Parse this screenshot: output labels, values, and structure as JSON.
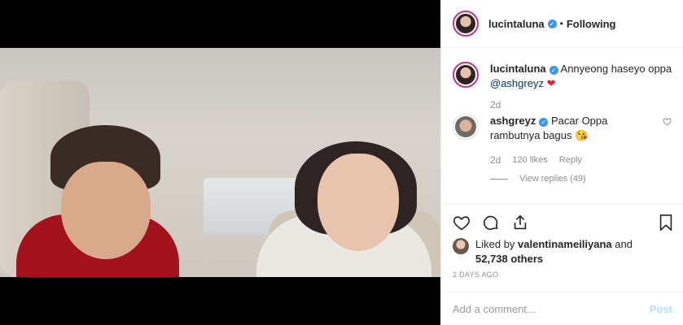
{
  "header": {
    "username": "lucintaluna",
    "separator": "•",
    "follow_status": "Following"
  },
  "caption": {
    "username": "lucintaluna",
    "text": "Annyeong haseyo oppa",
    "mention": "@ashgreyz",
    "emoji": "❤",
    "time": "2d"
  },
  "comment": {
    "username": "ashgreyz",
    "text": "Pacar Oppa rambutnya bagus",
    "emoji": "😘",
    "time": "2d",
    "likes": "120 likes",
    "reply_label": "Reply",
    "view_replies": "View replies (49)"
  },
  "likes": {
    "prefix": "Liked by",
    "user": "valentinameiliyana",
    "connector": "and",
    "others": "52,738 others"
  },
  "timestamp": "2 DAYS AGO",
  "add_comment": {
    "placeholder": "Add a comment...",
    "post_label": "Post"
  },
  "icons": {
    "like": "heart-icon",
    "comment": "comment-icon",
    "share": "share-icon",
    "save": "bookmark-icon",
    "verified": "verified-badge-icon"
  },
  "colors": {
    "verified": "#3897f0",
    "mention": "#003569",
    "post_disabled": "#b2dffc",
    "muted": "#8e8e8e"
  }
}
